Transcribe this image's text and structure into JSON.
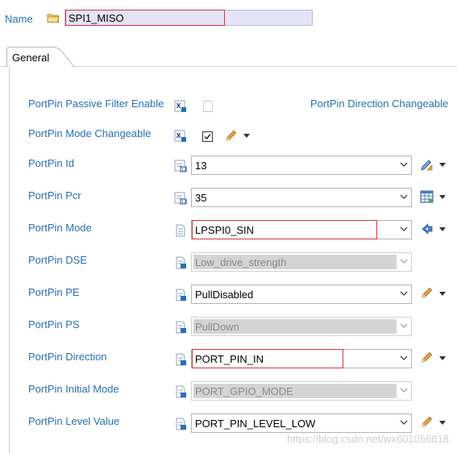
{
  "header": {
    "name_label": "Name",
    "name_value": "SPI1_MISO"
  },
  "tabs": [
    {
      "label": "General",
      "active": true
    }
  ],
  "fields": {
    "passive_filter": {
      "label": "PortPin Passive Filter Enable",
      "checked": false,
      "enabled": false
    },
    "direction_changeable": {
      "label": "PortPin Direction Changeable"
    },
    "mode_changeable": {
      "label": "PortPin Mode Changeable",
      "checked": true
    },
    "id": {
      "label": "PortPin Id",
      "value": "13"
    },
    "pcr": {
      "label": "PortPin Pcr",
      "value": "35"
    },
    "mode": {
      "label": "PortPin Mode",
      "value": "LPSPI0_SIN"
    },
    "dse": {
      "label": "PortPin DSE",
      "value": "Low_drive_strength",
      "enabled": false
    },
    "pe": {
      "label": "PortPin PE",
      "value": "PullDisabled"
    },
    "ps": {
      "label": "PortPin PS",
      "value": "PullDown",
      "enabled": false
    },
    "direction": {
      "label": "PortPin Direction",
      "value": "PORT_PIN_IN"
    },
    "initial_mode": {
      "label": "PortPin Initial Mode",
      "value": "PORT_GPIO_MODE",
      "enabled": false
    },
    "level_value": {
      "label": "PortPin Level Value",
      "value": "PORT_PIN_LEVEL_LOW"
    }
  },
  "colors": {
    "label_blue": "#2b6fb3",
    "highlight_red": "#d9343c",
    "name_field_bg": "#e4e4f7"
  },
  "icons": {
    "name": "folder-icon",
    "calc_value": "calculator-icon",
    "derived_value": "derived-doc-icon",
    "user_value": "pencil-icon"
  },
  "watermark": "https://blog.csdn.net/wx601056818"
}
